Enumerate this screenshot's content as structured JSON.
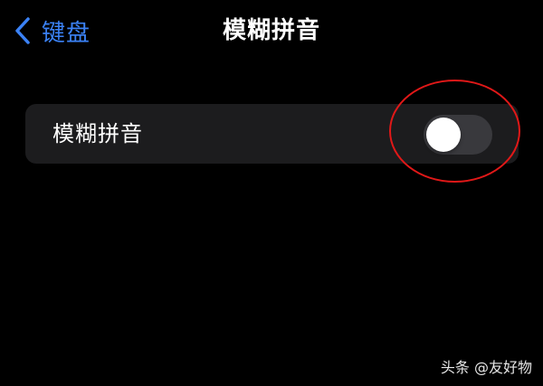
{
  "nav": {
    "back_label": "键盘",
    "back_icon": "chevron-left-icon",
    "title": "模糊拼音"
  },
  "settings": {
    "rows": [
      {
        "label": "模糊拼音",
        "toggle_on": false
      }
    ]
  },
  "watermark": {
    "text": "头条 @友好物"
  },
  "colors": {
    "background": "#000000",
    "cell_background": "#1c1c1e",
    "accent": "#3b82f6",
    "toggle_off": "#39393d",
    "annotation": "#e01818"
  }
}
